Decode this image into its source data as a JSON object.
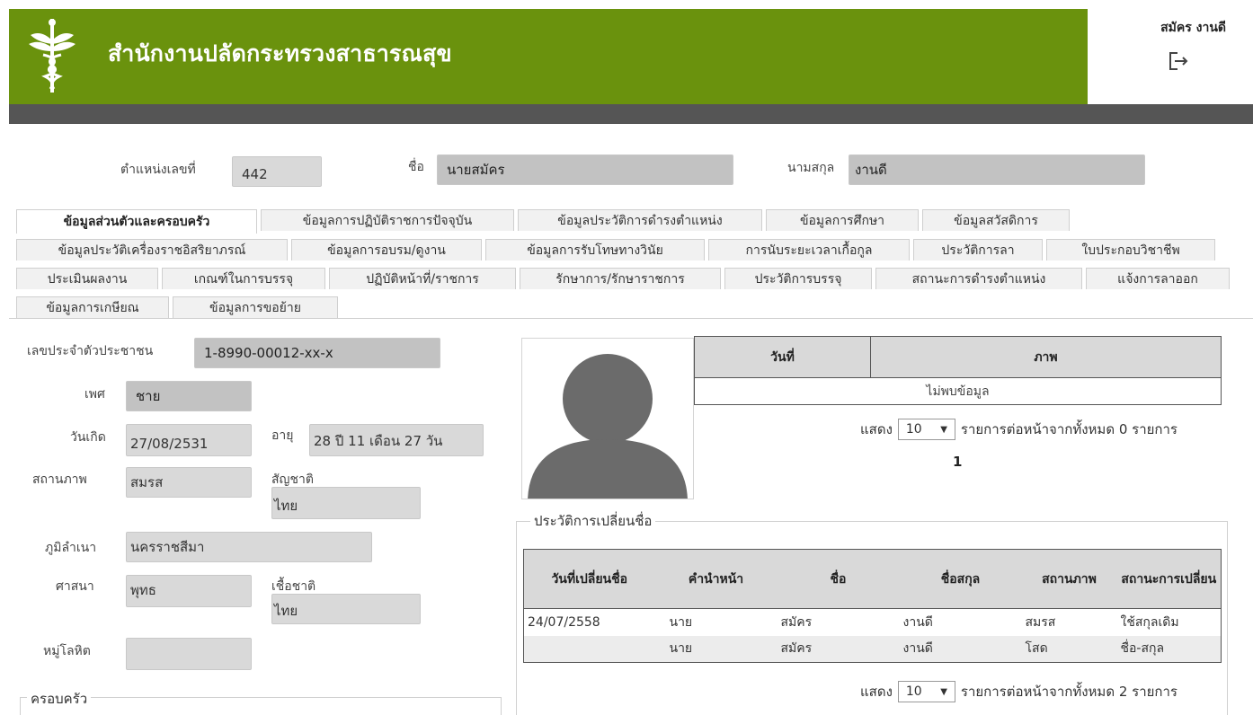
{
  "header": {
    "title": "สำนักงานปลัดกระทรวงสาธารณสุข",
    "user_name": "สมัคร งานดี",
    "brand_color": "#6a920d",
    "logout_icon": "logout-icon"
  },
  "top_fields": {
    "position_label": "ตำแหน่งเลขที่",
    "position_value": "442",
    "name_label": "ชื่อ",
    "name_value": "นายสมัคร",
    "surname_label": "นามสกุล",
    "surname_value": "งานดี"
  },
  "tabs": [
    "ข้อมูลส่วนตัวและครอบครัว",
    "ข้อมูลการปฏิบัติราชการปัจจุบัน",
    "ข้อมูลประวัติการดำรงตำแหน่ง",
    "ข้อมูลการศึกษา",
    "ข้อมูลสวัสดิการ",
    "ข้อมูลประวัติเครื่องราชอิสริยาภรณ์",
    "ข้อมูลการอบรม/ดูงาน",
    "ข้อมูลการรับโทษทางวินัย",
    "การนับระยะเวลาเกื้อกูล",
    "ประวัติการลา",
    "ใบประกอบวิชาชีพ",
    "ประเมินผลงาน",
    "เกณฑ์ในการบรรจุ",
    "ปฏิบัติหน้าที่/ราชการ",
    "รักษาการ/รักษาราชการ",
    "ประวัติการบรรจุ",
    "สถานะการดำรงตำแหน่ง",
    "แจ้งการลาออก",
    "ข้อมูลการเกษียณ",
    "ข้อมูลการขอย้าย"
  ],
  "personal": {
    "id_label": "เลขประจำตัวประชาชน",
    "id_value": "1-8990-00012-xx-x",
    "gender_label": "เพศ",
    "gender_value": "ชาย",
    "birth_label": "วันเกิด",
    "birth_value": "27/08/2531",
    "age_label": "อายุ",
    "age_value": "28 ปี 11 เดือน 27 วัน",
    "marital_label": "สถานภาพ",
    "marital_value": "สมรส",
    "nationality_label": "สัญชาติ",
    "nationality_value": "ไทย",
    "hometown_label": "ภูมิลำเนา",
    "hometown_value": "นครราชสีมา",
    "religion_label": "ศาสนา",
    "religion_value": "พุทธ",
    "ethnicity_label": "เชื้อชาติ",
    "ethnicity_value": "ไทย",
    "blood_label": "หมู่โลหิต",
    "blood_value": "",
    "family_legend": "ครอบครัว"
  },
  "photo_table": {
    "headers": [
      "วันที่",
      "ภาพ"
    ],
    "empty_text": "ไม่พบข้อมูล",
    "show_label": "แสดง",
    "page_size": "10",
    "summary": "รายการต่อหน้าจากทั้งหมด 0 รายการ",
    "page": "1"
  },
  "name_history": {
    "legend": "ประวัติการเปลี่ยนชื่อ",
    "headers": [
      "วันที่เปลี่ยนชื่อ",
      "คำนำหน้า",
      "ชื่อ",
      "ชื่อสกุล",
      "สถานภาพ",
      "สถานะการเปลี่ยน"
    ],
    "rows": [
      [
        "24/07/2558",
        "นาย",
        "สมัคร",
        "งานดี",
        "สมรส",
        "ใช้สกุลเดิม"
      ],
      [
        "",
        "นาย",
        "สมัคร",
        "งานดี",
        "โสด",
        "ชื่อ-สกุล"
      ]
    ],
    "show_label": "แสดง",
    "page_size": "10",
    "summary": "รายการต่อหน้าจากทั้งหมด 2 รายการ"
  }
}
